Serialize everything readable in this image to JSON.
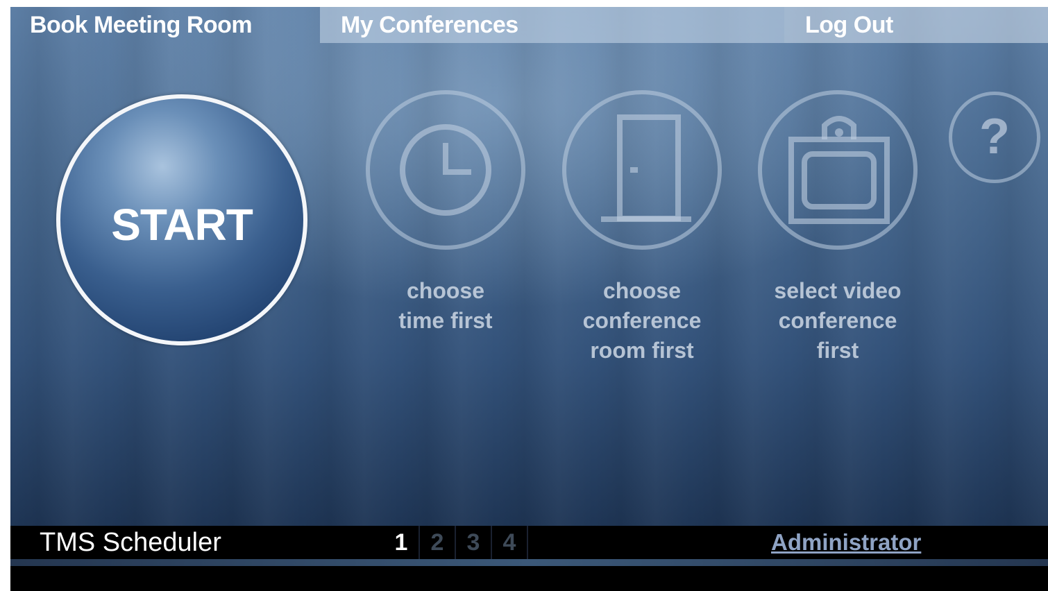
{
  "nav": {
    "book_meeting_room": "Book Meeting Room",
    "my_conferences": "My Conferences",
    "log_out": "Log Out"
  },
  "start": {
    "label": "START"
  },
  "options": [
    {
      "icon": "clock-icon",
      "label_lines": [
        "choose",
        "time first"
      ]
    },
    {
      "icon": "door-icon",
      "label_lines": [
        "choose",
        "conference",
        "room first"
      ]
    },
    {
      "icon": "video-screen-icon",
      "label_lines": [
        "select video",
        "conference",
        "first"
      ]
    }
  ],
  "help": {
    "icon": "question-icon",
    "label": "?"
  },
  "footer": {
    "app_name": "TMS Scheduler",
    "steps": [
      "1",
      "2",
      "3",
      "4"
    ],
    "active_step": "1",
    "user": "Administrator"
  },
  "colors": {
    "background": "#3a5a82",
    "tab_my_conferences": "#bed0e4",
    "footer": "#000000",
    "user_link": "#8fa3c4"
  }
}
